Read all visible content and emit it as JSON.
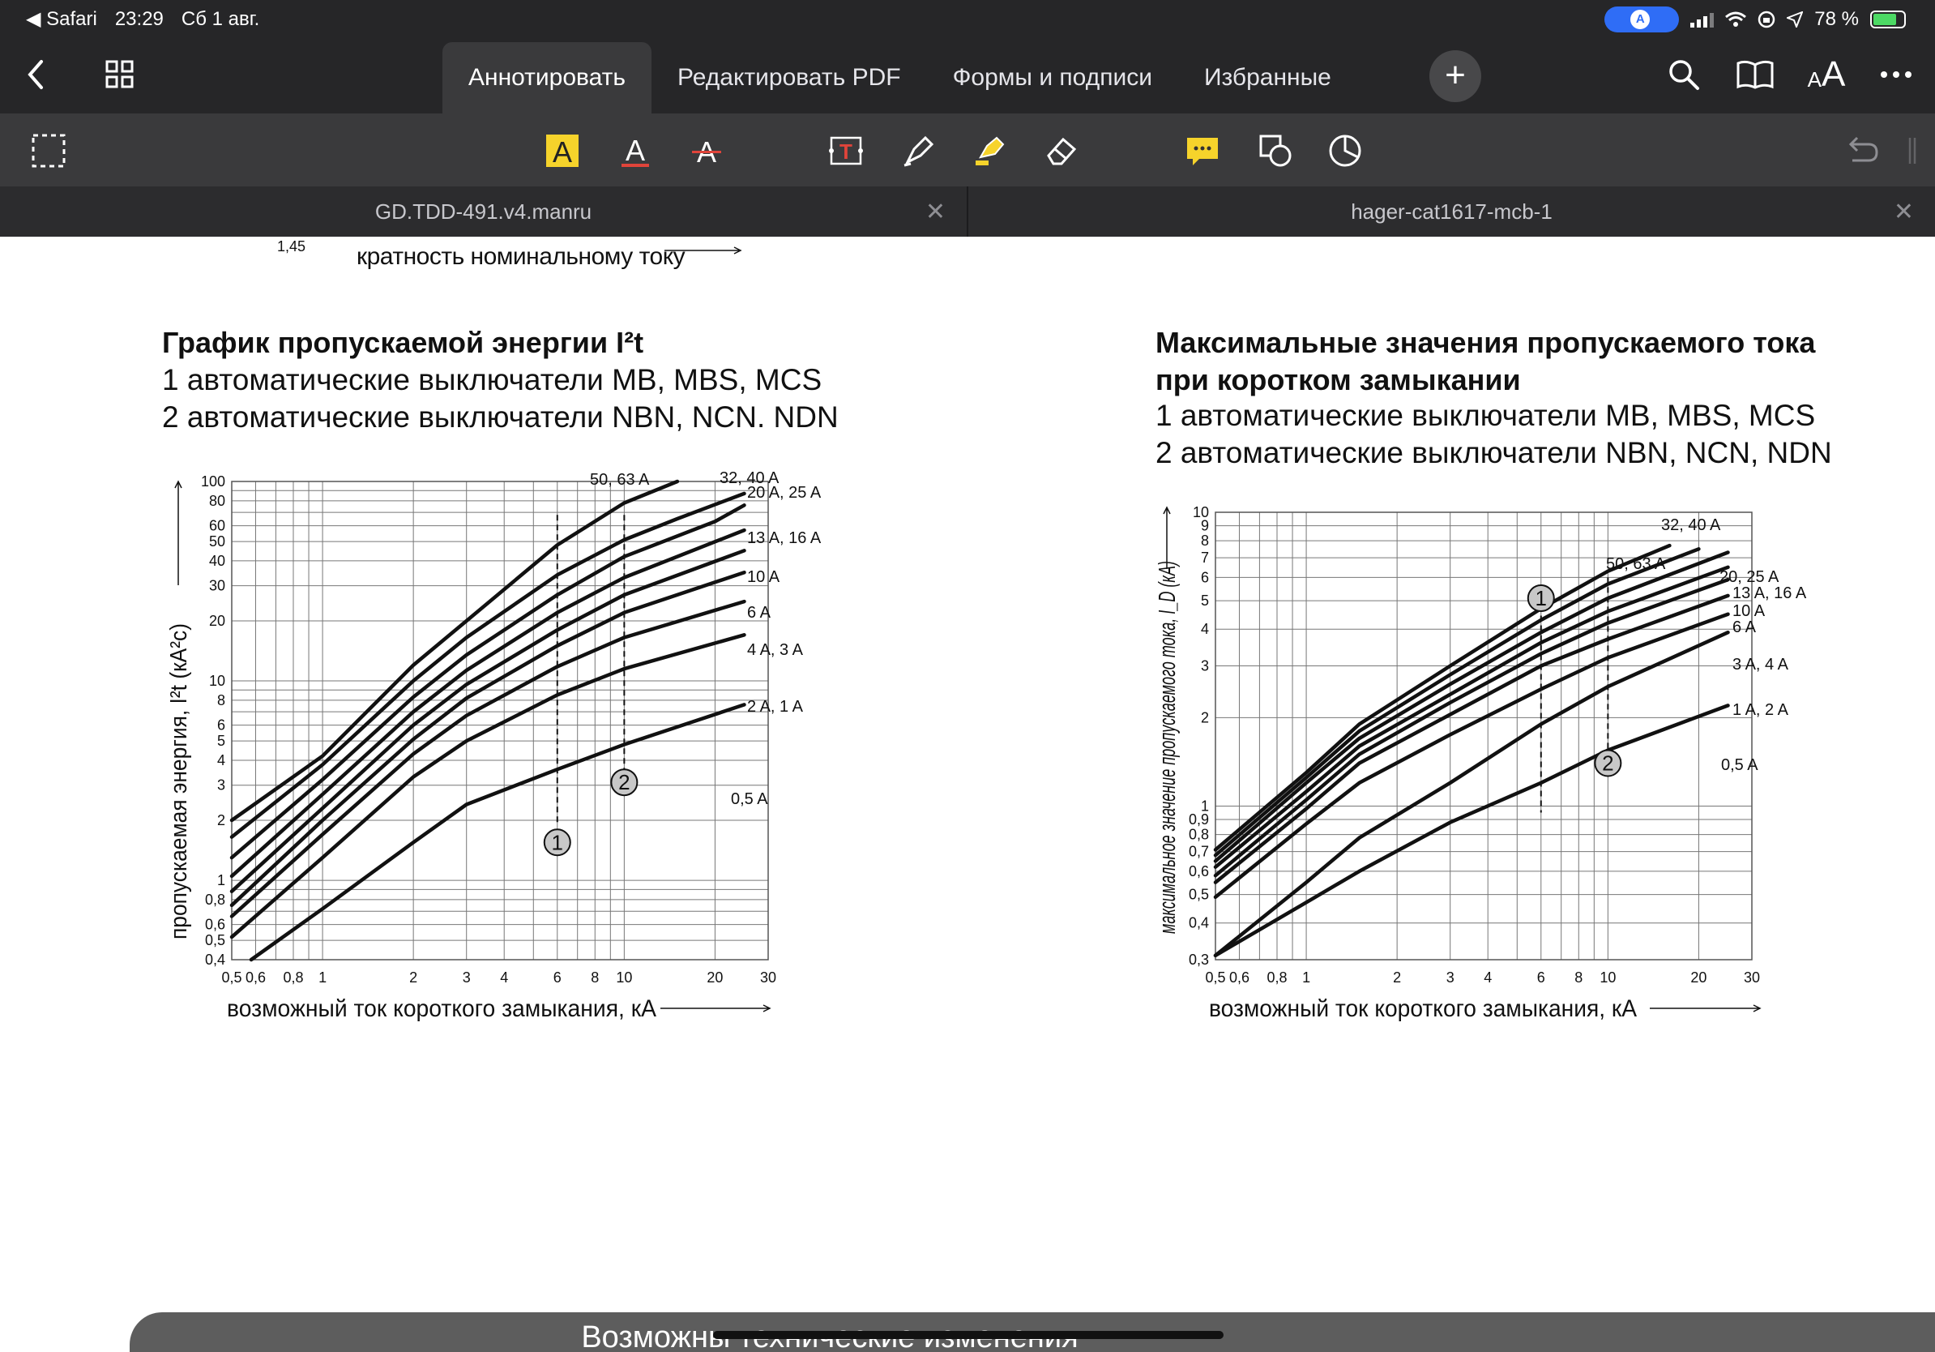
{
  "status_bar": {
    "back_app": "◀ Safari",
    "time": "23:29",
    "date": "Сб 1 авг.",
    "battery": "78 %"
  },
  "toolbar": {
    "tabs": [
      "Аннотировать",
      "Редактировать PDF",
      "Формы и подписи",
      "Избранные"
    ],
    "active_tab": "Аннотировать",
    "text_size_label": "AA"
  },
  "doc_tabs": [
    "GD.TDD-491.v4.manru",
    "hager-cat1617-mcb-1"
  ],
  "page": {
    "top_fragment": {
      "tick": "1,45",
      "axis_label": "кратность номинальному току"
    },
    "left": {
      "title": "График пропускаемой энергии I²t",
      "line1": "1  автоматические выключатели MB, MBS, MCS",
      "line2": "2  автоматические выключатели NBN, NCN. NDN"
    },
    "right": {
      "title1": "Максимальные значения пропускаемого тока",
      "title2": "при коротком замыкании",
      "line1": "1  автоматические выключатели MB, MBS, MCS",
      "line2": "2  автоматические выключатели NBN, NCN, NDN"
    },
    "footer": "Возможны технические изменения"
  },
  "chart_data": [
    {
      "type": "line",
      "log_x": true,
      "log_y": true,
      "xlim": [
        0.5,
        30
      ],
      "ylim": [
        0.4,
        100
      ],
      "xlabel": "возможный ток короткого замыкания, кА",
      "ylabel": "пропускаемая энергия, I²t (кА²с)",
      "x_ticks": [
        "0,5",
        "0,6",
        "0,8",
        "1",
        "2",
        "3",
        "4",
        "6",
        "8",
        "10",
        "20",
        "30"
      ],
      "y_ticks": [
        "0,4",
        "0,5",
        "0,6",
        "0,8",
        "1",
        "2",
        "3",
        "4",
        "5",
        "6",
        "8",
        "10",
        "20",
        "30",
        "40",
        "50",
        "60",
        "80",
        "100"
      ],
      "grid": true,
      "series": [
        {
          "name": "50, 63 A",
          "points": [
            [
              0.5,
              2.0
            ],
            [
              1,
              4.2
            ],
            [
              2,
              12
            ],
            [
              3,
              20
            ],
            [
              6,
              48
            ],
            [
              10,
              78
            ],
            [
              15,
              100
            ]
          ]
        },
        {
          "name": "32, 40 A",
          "points": [
            [
              0.5,
              1.65
            ],
            [
              1,
              3.8
            ],
            [
              2,
              10
            ],
            [
              3,
              16.5
            ],
            [
              6,
              34
            ],
            [
              10,
              51
            ],
            [
              15,
              65
            ],
            [
              25,
              87
            ]
          ]
        },
        {
          "name": "20 A, 25 A",
          "points": [
            [
              0.5,
              1.3
            ],
            [
              1,
              3.2
            ],
            [
              2,
              8.3
            ],
            [
              3,
              13.5
            ],
            [
              6,
              27
            ],
            [
              10,
              42
            ],
            [
              20,
              63
            ],
            [
              25,
              76
            ]
          ]
        },
        {
          "name": "13 A, 16 A",
          "points": [
            [
              0.5,
              1.05
            ],
            [
              1,
              2.7
            ],
            [
              2,
              7
            ],
            [
              3,
              11.3
            ],
            [
              6,
              22
            ],
            [
              10,
              33
            ],
            [
              25,
              57
            ]
          ]
        },
        {
          "name": "10 A",
          "points": [
            [
              0.5,
              0.88
            ],
            [
              1,
              2.3
            ],
            [
              2,
              6
            ],
            [
              3,
              9.6
            ],
            [
              6,
              18
            ],
            [
              10,
              27
            ],
            [
              25,
              45
            ]
          ]
        },
        {
          "name": "6 A",
          "points": [
            [
              0.5,
              0.75
            ],
            [
              1,
              2.0
            ],
            [
              2,
              5.1
            ],
            [
              3,
              8.2
            ],
            [
              6,
              15
            ],
            [
              10,
              22
            ],
            [
              25,
              35
            ]
          ]
        },
        {
          "name": "4 A, 3 A",
          "points": [
            [
              0.5,
              0.66
            ],
            [
              1,
              1.7
            ],
            [
              2,
              4.3
            ],
            [
              3,
              6.7
            ],
            [
              6,
              11.8
            ],
            [
              10,
              16.5
            ],
            [
              25,
              25
            ]
          ]
        },
        {
          "name": "2 A, 1 A",
          "points": [
            [
              0.5,
              0.52
            ],
            [
              1,
              1.3
            ],
            [
              2,
              3.3
            ],
            [
              3,
              5
            ],
            [
              6,
              8.5
            ],
            [
              10,
              11.5
            ],
            [
              25,
              17
            ]
          ]
        },
        {
          "name": "0,5 A",
          "points": [
            [
              0.58,
              0.4
            ],
            [
              1,
              0.72
            ],
            [
              2,
              1.55
            ],
            [
              3,
              2.4
            ],
            [
              6,
              3.6
            ],
            [
              10,
              4.8
            ],
            [
              25,
              7.6
            ]
          ]
        }
      ],
      "markers": [
        {
          "label": "1",
          "x": 6,
          "y": 1.55
        },
        {
          "label": "2",
          "x": 10,
          "y": 3.1
        }
      ],
      "dashed_lines": [
        {
          "x": 6,
          "y_from": 1.9,
          "y_to": 68
        },
        {
          "x": 10,
          "y_from": 3.5,
          "y_to": 68
        }
      ]
    },
    {
      "type": "line",
      "log_x": true,
      "log_y": true,
      "xlim": [
        0.5,
        30
      ],
      "ylim": [
        0.3,
        10
      ],
      "xlabel": "возможный ток короткого замыкания, кА",
      "ylabel": "максимальное значение пропускаемого тока, I_D (кА)",
      "x_ticks": [
        "0,5",
        "0,6",
        "0,8",
        "1",
        "2",
        "3",
        "4",
        "6",
        "8",
        "10",
        "20",
        "30"
      ],
      "y_ticks": [
        "0,3",
        "0,4",
        "0,5",
        "0,6",
        "0,7",
        "0,8",
        "0,9",
        "1",
        "2",
        "3",
        "4",
        "5",
        "6",
        "7",
        "8",
        "9",
        "10"
      ],
      "grid": true,
      "series": [
        {
          "name": "50, 63 A",
          "points": [
            [
              0.5,
              0.71
            ],
            [
              1,
              1.3
            ],
            [
              1.5,
              1.9
            ],
            [
              3,
              3.0
            ],
            [
              6,
              4.7
            ],
            [
              10,
              6.3
            ],
            [
              16,
              7.7
            ]
          ]
        },
        {
          "name": "32, 40 A",
          "points": [
            [
              0.5,
              0.68
            ],
            [
              1,
              1.25
            ],
            [
              1.5,
              1.8
            ],
            [
              3,
              2.8
            ],
            [
              6,
              4.3
            ],
            [
              10,
              5.7
            ],
            [
              20,
              7.5
            ]
          ]
        },
        {
          "name": "20, 25 A",
          "points": [
            [
              0.5,
              0.65
            ],
            [
              1,
              1.2
            ],
            [
              1.5,
              1.7
            ],
            [
              3,
              2.6
            ],
            [
              6,
              3.9
            ],
            [
              10,
              5.1
            ],
            [
              25,
              7.3
            ]
          ]
        },
        {
          "name": "13 A, 16 A",
          "points": [
            [
              0.5,
              0.62
            ],
            [
              1,
              1.12
            ],
            [
              1.5,
              1.6
            ],
            [
              3,
              2.4
            ],
            [
              6,
              3.6
            ],
            [
              10,
              4.6
            ],
            [
              25,
              6.5
            ]
          ]
        },
        {
          "name": "10 A",
          "points": [
            [
              0.5,
              0.58
            ],
            [
              1,
              1.05
            ],
            [
              1.5,
              1.5
            ],
            [
              3,
              2.25
            ],
            [
              6,
              3.3
            ],
            [
              10,
              4.2
            ],
            [
              25,
              5.9
            ]
          ]
        },
        {
          "name": "6 A",
          "points": [
            [
              0.5,
              0.55
            ],
            [
              1,
              0.98
            ],
            [
              1.5,
              1.4
            ],
            [
              3,
              2.05
            ],
            [
              6,
              3.0
            ],
            [
              10,
              3.7
            ],
            [
              25,
              5.2
            ]
          ]
        },
        {
          "name": "3 A, 4 A",
          "points": [
            [
              0.5,
              0.49
            ],
            [
              1,
              0.87
            ],
            [
              1.5,
              1.2
            ],
            [
              3,
              1.75
            ],
            [
              6,
              2.5
            ],
            [
              10,
              3.2
            ],
            [
              25,
              4.5
            ]
          ]
        },
        {
          "name": "1 A, 2 A",
          "points": [
            [
              0.5,
              0.31
            ],
            [
              1,
              0.55
            ],
            [
              1.5,
              0.78
            ],
            [
              3,
              1.2
            ],
            [
              6,
              1.9
            ],
            [
              10,
              2.55
            ],
            [
              25,
              3.9
            ]
          ]
        },
        {
          "name": "0,5 A",
          "points": [
            [
              0.5,
              0.31
            ],
            [
              1,
              0.47
            ],
            [
              1.5,
              0.6
            ],
            [
              3,
              0.88
            ],
            [
              6,
              1.2
            ],
            [
              10,
              1.55
            ],
            [
              25,
              2.2
            ]
          ]
        }
      ],
      "markers": [
        {
          "label": "1",
          "x": 6,
          "y": 5.1
        },
        {
          "label": "2",
          "x": 10,
          "y": 1.4
        }
      ],
      "dashed_lines": [
        {
          "x": 6,
          "y_from": 0.95,
          "y_to": 4.8
        },
        {
          "x": 10,
          "y_from": 1.5,
          "y_to": 6
        }
      ]
    }
  ]
}
